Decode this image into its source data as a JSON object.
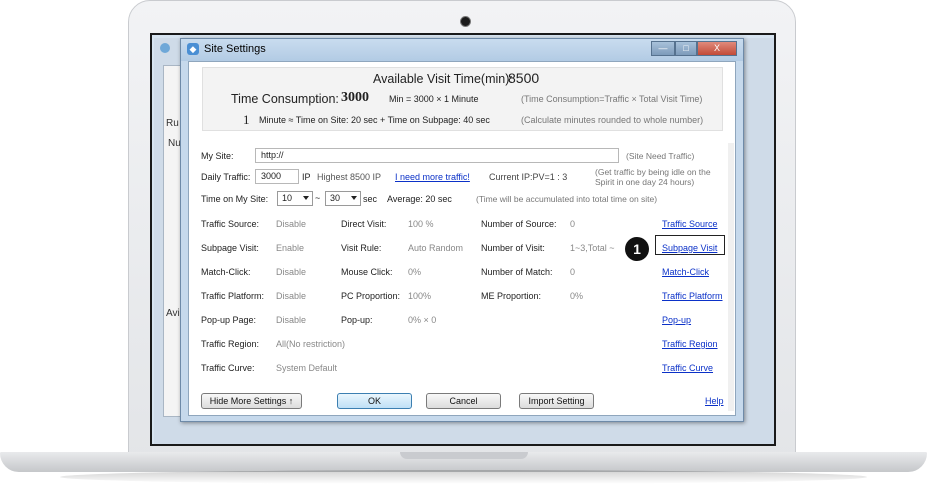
{
  "dialog": {
    "title": "Site Settings",
    "win_controls": {
      "minimize": "—",
      "maximize": "□",
      "close": "X"
    }
  },
  "background_app": {
    "label_a": "Ru",
    "label_b": "Nu",
    "label_c": "Avi"
  },
  "summary": {
    "available_label": "Available Visit Time(min):",
    "available_value": "8500",
    "consumption_label": "Time Consumption:",
    "consumption_value": "3000",
    "consumption_formula": "Min = 3000 ×   1    Minute",
    "consumption_note": "(Time Consumption=Traffic × Total Visit Time)",
    "minute_value": "1",
    "minute_formula": "Minute ≈ Time on Site: 20 sec + Time on Subpage: 40 sec",
    "minute_note": "(Calculate minutes rounded to whole number)"
  },
  "site": {
    "label": "My Site:",
    "url_value": "http://",
    "note": "(Site Need Traffic)"
  },
  "daily": {
    "label": "Daily Traffic:",
    "value": "3000",
    "unit": "IP",
    "highest": "Highest 8500 IP",
    "more_link": "I need more traffic!",
    "current": "Current IP:PV=1 : 3",
    "note_line1": "(Get traffic by being idle on the",
    "note_line2": "Spirit in one day 24 hours)"
  },
  "time_on_site": {
    "label": "Time on My Site:",
    "from": "10",
    "tilde": "~",
    "to": "30",
    "unit": "sec",
    "average": "Average: 20 sec",
    "note": "(Time will be accumulated into total time on site)"
  },
  "settings": {
    "traffic_source": {
      "label": "Traffic Source:",
      "value": "Disable",
      "link": "Traffic Source"
    },
    "direct_visit": {
      "label": "Direct Visit:",
      "value": "100 %"
    },
    "number_of_source": {
      "label": "Number of Source:",
      "value": "0"
    },
    "subpage_visit": {
      "label": "Subpage Visit:",
      "value": "Enable",
      "link": "Subpage Visit"
    },
    "visit_rule": {
      "label": "Visit Rule:",
      "value": "Auto Random"
    },
    "number_of_visit": {
      "label": "Number of Visit:",
      "value": "1~3,Total ~"
    },
    "match_click": {
      "label": "Match-Click:",
      "value": "Disable",
      "link": "Match-Click"
    },
    "mouse_click": {
      "label": "Mouse Click:",
      "value": "0%"
    },
    "number_of_match": {
      "label": "Number of Match:",
      "value": "0"
    },
    "traffic_platform": {
      "label": "Traffic Platform:",
      "value": "Disable",
      "link": "Traffic Platform"
    },
    "pc_proportion": {
      "label": "PC Proportion:",
      "value": "100%"
    },
    "me_proportion": {
      "label": "ME Proportion:",
      "value": "0%"
    },
    "popup_page": {
      "label": "Pop-up Page:",
      "value": "Disable",
      "link": "Pop-up"
    },
    "popup": {
      "label": "Pop-up:",
      "value": "0% × 0"
    },
    "traffic_region": {
      "label": "Traffic Region:",
      "value": "All(No restriction)",
      "link": "Traffic Region"
    },
    "traffic_curve": {
      "label": "Traffic Curve:",
      "value": "System Default",
      "link": "Traffic Curve"
    }
  },
  "callout_number": "1",
  "buttons": {
    "hide_more": "Hide More Settings ↑",
    "ok": "OK",
    "cancel": "Cancel",
    "import": "Import Setting",
    "help": "Help"
  }
}
